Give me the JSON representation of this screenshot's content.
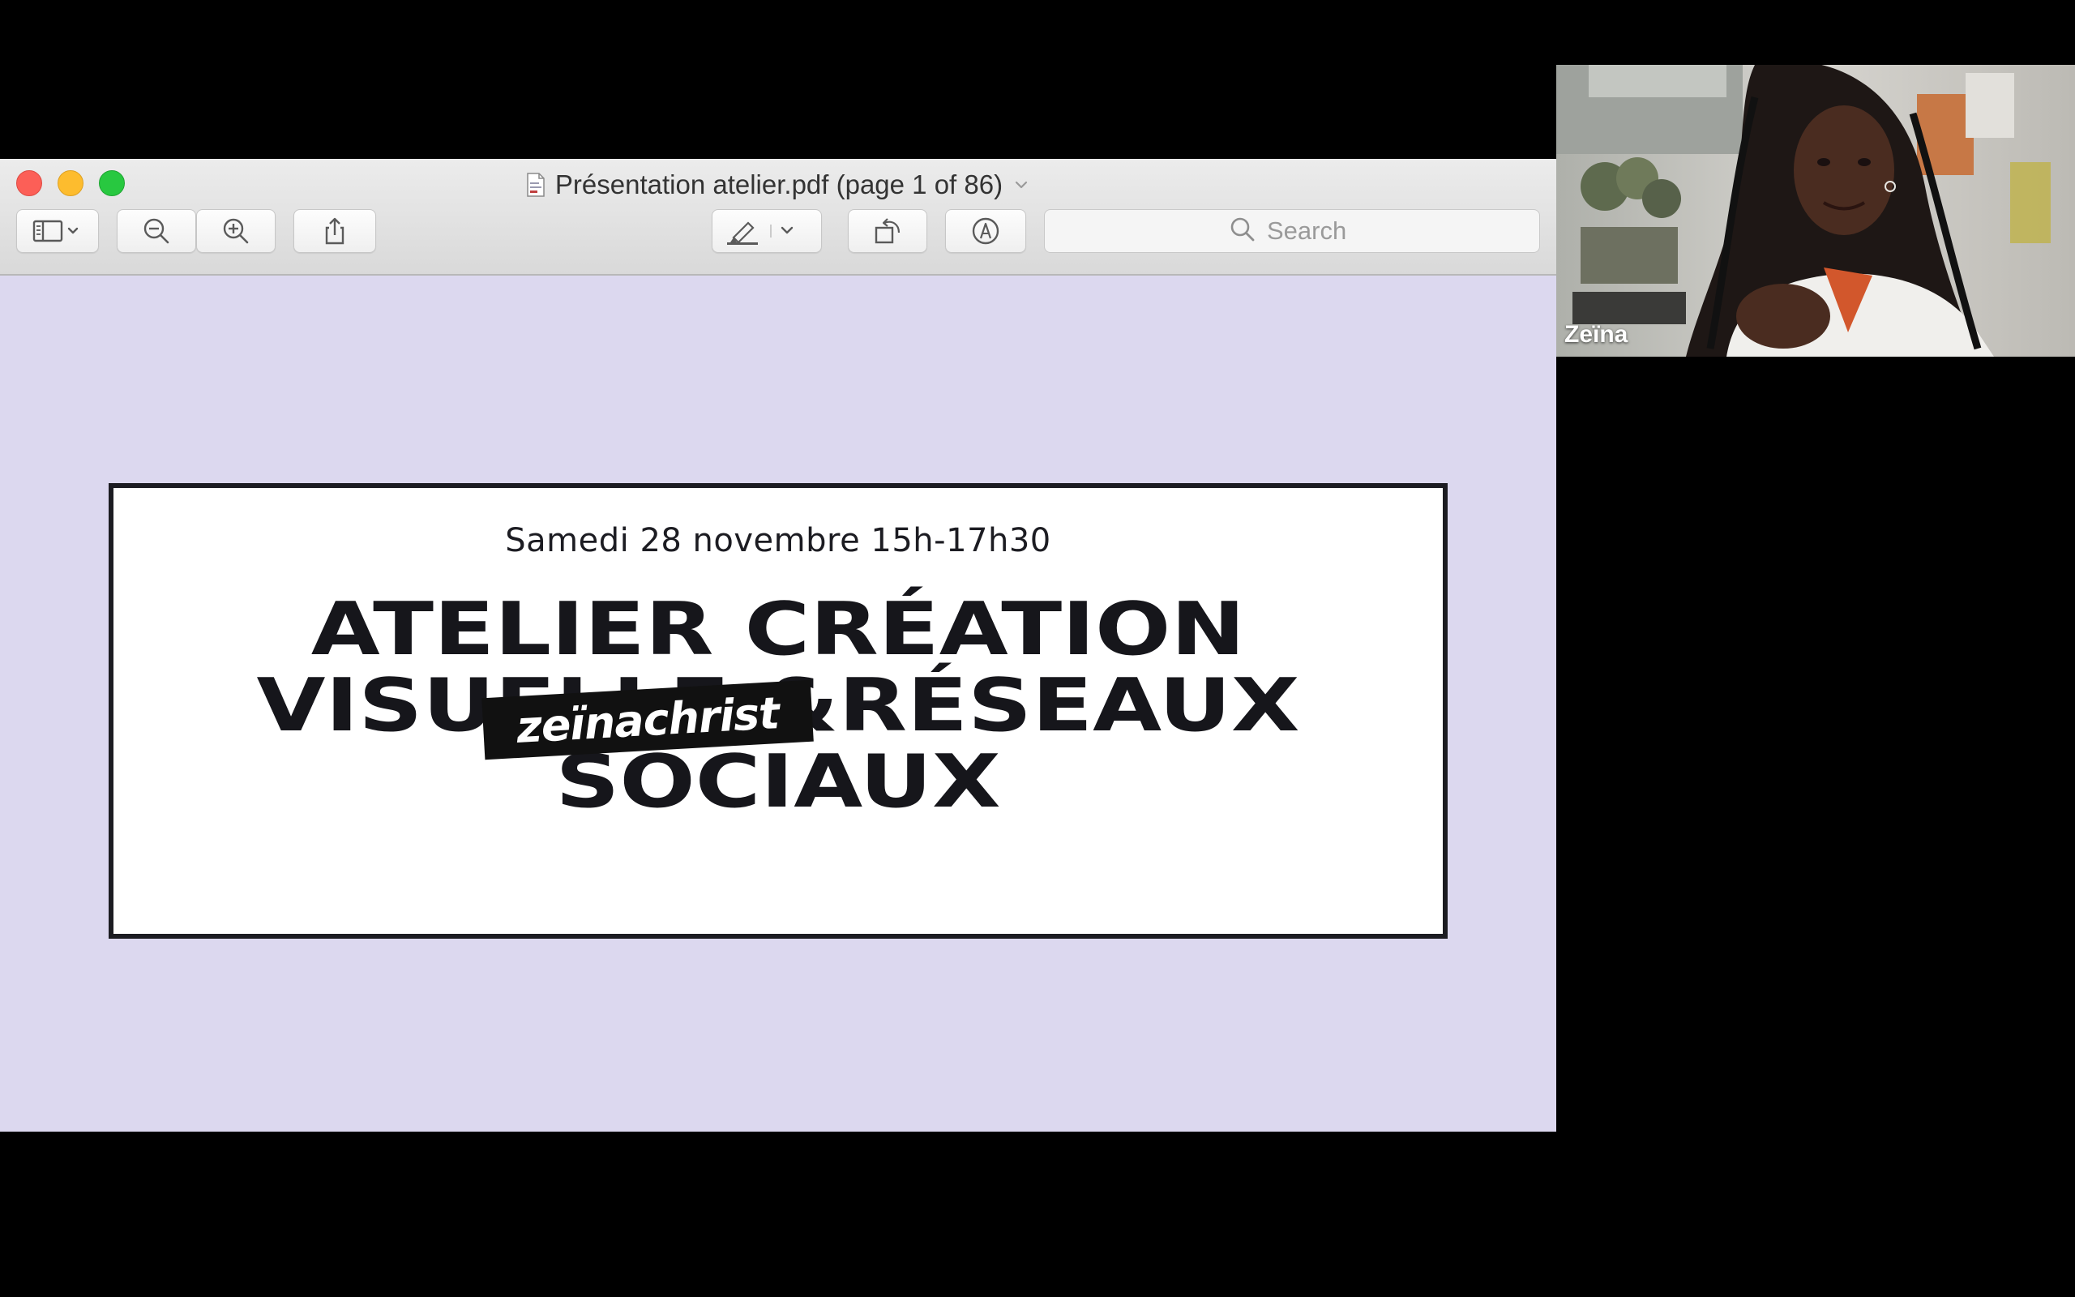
{
  "window": {
    "title": "Présentation atelier.pdf (page 1 of 86)"
  },
  "toolbar": {
    "search_placeholder": "Search",
    "icons": [
      "sidebar-icon",
      "zoom-out-icon",
      "zoom-in-icon",
      "share-icon",
      "highlight-icon",
      "rotate-icon",
      "markup-icon",
      "search-icon"
    ]
  },
  "slide": {
    "date": "Samedi 28 novembre 15h-17h30",
    "title_lines": [
      "ATELIER CRÉATION",
      "VISUELLE &RÉSEAUX",
      "SOCIAUX"
    ],
    "brand": "zeïnachrist",
    "background_color": "#dcd8ef"
  },
  "video": {
    "participant_name": "Zeïna"
  },
  "colors": {
    "close": "#fc5f57",
    "minimize": "#fdbc2e",
    "zoom": "#28c840"
  }
}
